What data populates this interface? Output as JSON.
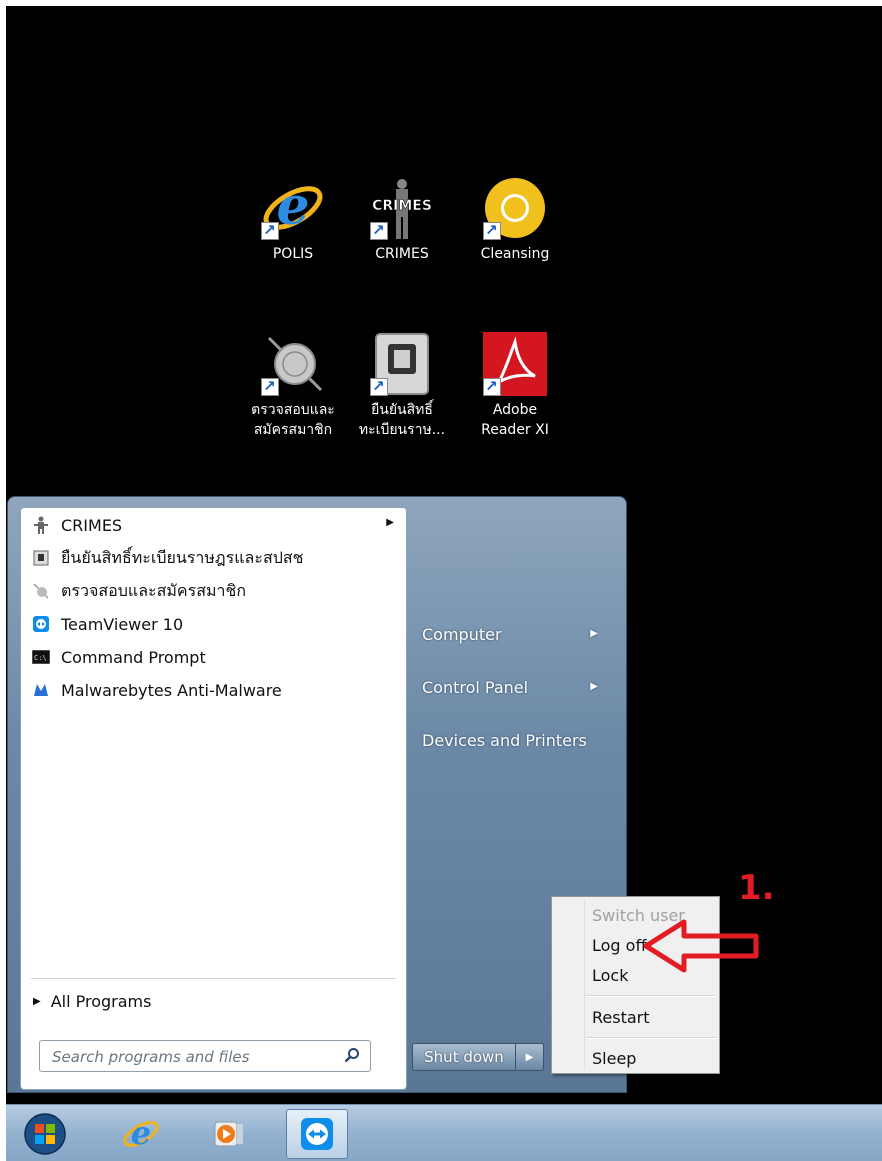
{
  "desktop": {
    "icons": [
      {
        "label_1": "POLIS",
        "label_2": "",
        "icon": "internet-explorer-icon"
      },
      {
        "label_1": "CRIMES",
        "label_2": "",
        "icon": "crimes-app-icon"
      },
      {
        "label_1": "Cleansing",
        "label_2": "",
        "icon": "chrome-icon"
      },
      {
        "label_1": "ตรวจสอบและ",
        "label_2": "สมัครสมาชิก",
        "icon": "seal-icon"
      },
      {
        "label_1": "ยืนยันสิทธิ์",
        "label_2": "ทะเบียนราษ...",
        "icon": "card-reader-icon"
      },
      {
        "label_1": "Adobe",
        "label_2": "Reader XI",
        "icon": "adobe-reader-icon"
      }
    ],
    "icon_badge": "shortcut-arrow-icon"
  },
  "start_menu": {
    "programs": [
      {
        "label": "CRIMES",
        "icon": "crimes-icon",
        "has_submenu": true
      },
      {
        "label": "ยืนยันสิทธิ์ทะเบียนราษฎรและสปสช",
        "icon": "card-reader-icon",
        "has_submenu": false
      },
      {
        "label": "ตรวจสอบและสมัครสมาชิก",
        "icon": "seal-icon",
        "has_submenu": false
      },
      {
        "label": "TeamViewer 10",
        "icon": "teamviewer-icon",
        "has_submenu": false
      },
      {
        "label": "Command Prompt",
        "icon": "command-prompt-icon",
        "has_submenu": false
      },
      {
        "label": "Malwarebytes Anti-Malware",
        "icon": "malwarebytes-icon",
        "has_submenu": false
      }
    ],
    "all_programs": "All Programs",
    "search_placeholder": "Search programs and files",
    "right_links": [
      {
        "label": "Computer",
        "has_submenu": true
      },
      {
        "label": "Control Panel",
        "has_submenu": true
      },
      {
        "label": "Devices and Printers",
        "has_submenu": false
      }
    ],
    "shutdown_label": "Shut down"
  },
  "shutdown_menu": {
    "items": [
      {
        "label": "Switch user",
        "enabled": false
      },
      {
        "label": "Log off",
        "enabled": true
      },
      {
        "label": "Lock",
        "enabled": true
      },
      {
        "label": "Restart",
        "enabled": true
      },
      {
        "label": "Sleep",
        "enabled": true
      }
    ]
  },
  "annotation": {
    "number": "1.",
    "color": "#e31b23"
  },
  "taskbar": {
    "items": [
      "start-orb-icon",
      "internet-explorer-icon",
      "media-player-icon",
      "teamviewer-icon"
    ]
  }
}
